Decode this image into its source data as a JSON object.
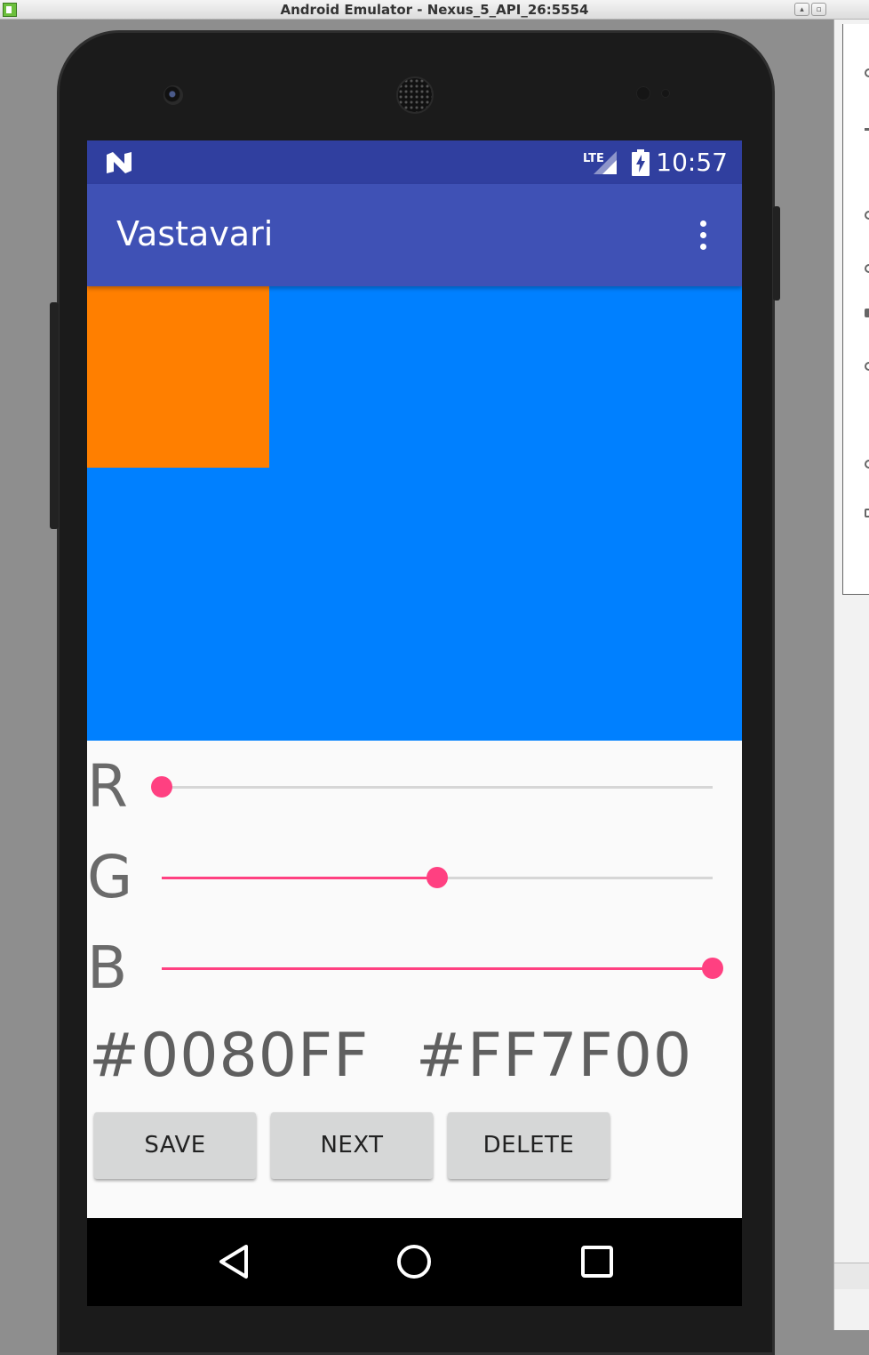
{
  "window": {
    "title": "Android Emulator - Nexus_5_API_26:5554"
  },
  "statusbar": {
    "time": "10:57",
    "network": "LTE"
  },
  "appbar": {
    "title": "Vastavari"
  },
  "colors": {
    "background_color": "#0080FF",
    "swatch_color": "#FF7F00",
    "accent": "#ff4081",
    "primary": "#3f51b5",
    "primary_dark": "#303f9f"
  },
  "sliders": [
    {
      "label": "R",
      "value_fraction": 0.0
    },
    {
      "label": "G",
      "value_fraction": 0.5
    },
    {
      "label": "B",
      "value_fraction": 1.0
    }
  ],
  "hex": {
    "left": "#0080FF",
    "right": "#FF7F00"
  },
  "buttons": {
    "save": "SAVE",
    "next": "NEXT",
    "delete": "DELETE"
  },
  "nav": {
    "back_icon": "back-triangle-icon",
    "home_icon": "home-circle-icon",
    "recents_icon": "recents-square-icon"
  }
}
